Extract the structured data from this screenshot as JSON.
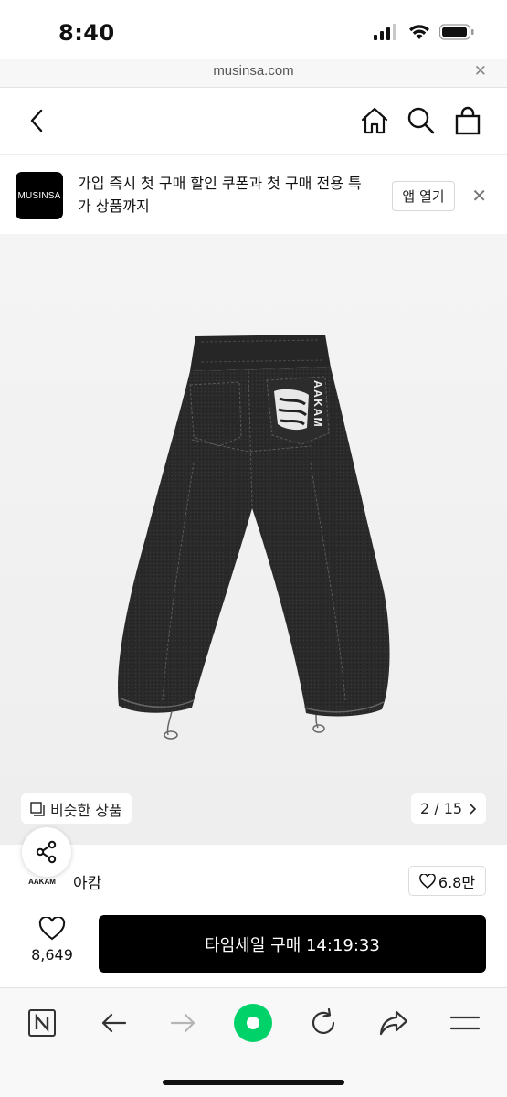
{
  "status_bar": {
    "time": "8:40"
  },
  "url_bar": {
    "domain": "musinsa.com",
    "close_icon": "close-icon"
  },
  "header": {
    "back_icon": "chevron-left-icon",
    "home_icon": "home-icon",
    "search_icon": "search-icon",
    "cart_icon": "shopping-bag-icon"
  },
  "promo": {
    "logo_text": "MUSINSA",
    "text": "가입 즉시 첫 구매 할인 쿠폰과 첫 구매 전용 특가 상품까지",
    "open_app_label": "앱 열기"
  },
  "product": {
    "similar_label": "비슷한 상품",
    "image_counter": "2 / 15",
    "print_text": "AAKAM"
  },
  "brand": {
    "logo_text": "AAKAM",
    "name": "아캄",
    "likes": "6.8만"
  },
  "purchase": {
    "wish_count": "8,649",
    "buy_label": "타임세일 구매 14:19:33"
  },
  "colors": {
    "primary": "#000000",
    "reload_green": "#00d26a",
    "background": "#ffffff"
  }
}
